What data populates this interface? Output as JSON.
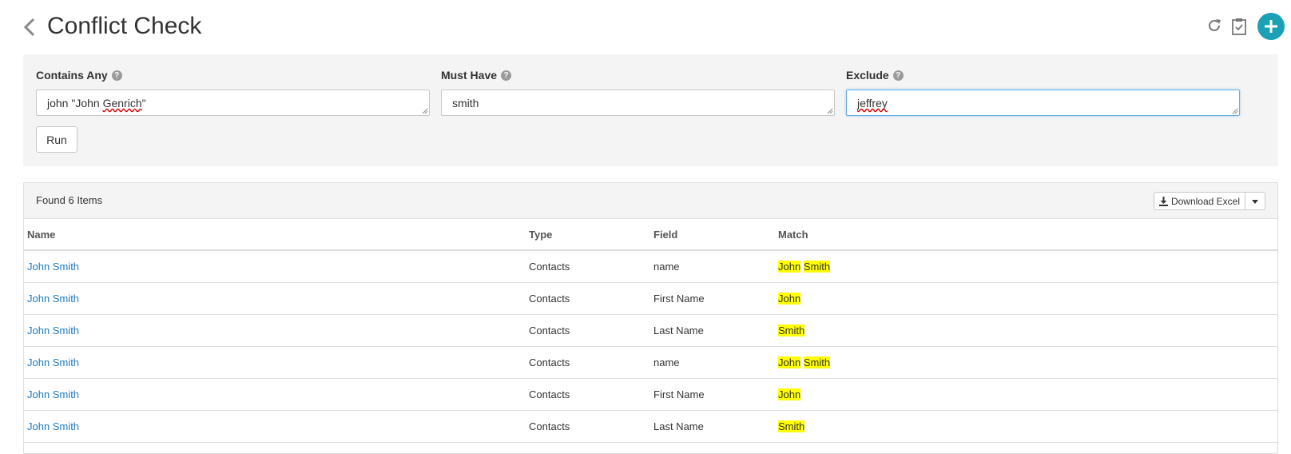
{
  "header": {
    "title": "Conflict Check",
    "icons": [
      "chevron-left-icon",
      "refresh-icon",
      "clipboard-check-icon",
      "plus-icon"
    ],
    "accent_color": "#1ba0b5"
  },
  "filters": {
    "contains_any": {
      "label": "Contains Any",
      "value_prefix": "john \"John ",
      "value_misspelled": "Genrich",
      "value_suffix": "\""
    },
    "must_have": {
      "label": "Must Have",
      "value": "smith"
    },
    "exclude": {
      "label": "Exclude",
      "value": "jeffrey"
    },
    "help_glyph": "?",
    "run_label": "Run"
  },
  "results": {
    "found_text": "Found 6 Items",
    "download_label": "Download Excel",
    "columns": [
      "Name",
      "Type",
      "Field",
      "Match"
    ],
    "rows": [
      {
        "name": "John Smith",
        "type": "Contacts",
        "field": "name",
        "match": [
          "John",
          "Smith"
        ]
      },
      {
        "name": "John Smith",
        "type": "Contacts",
        "field": "First Name",
        "match": [
          "John"
        ]
      },
      {
        "name": "John Smith",
        "type": "Contacts",
        "field": "Last Name",
        "match": [
          "Smith"
        ]
      },
      {
        "name": "John Smith",
        "type": "Contacts",
        "field": "name",
        "match": [
          "John",
          "Smith"
        ]
      },
      {
        "name": "John Smith",
        "type": "Contacts",
        "field": "First Name",
        "match": [
          "John"
        ]
      },
      {
        "name": "John Smith",
        "type": "Contacts",
        "field": "Last Name",
        "match": [
          "Smith"
        ]
      }
    ],
    "link_color": "#1f7bc1",
    "highlight_color": "#ffff00"
  }
}
